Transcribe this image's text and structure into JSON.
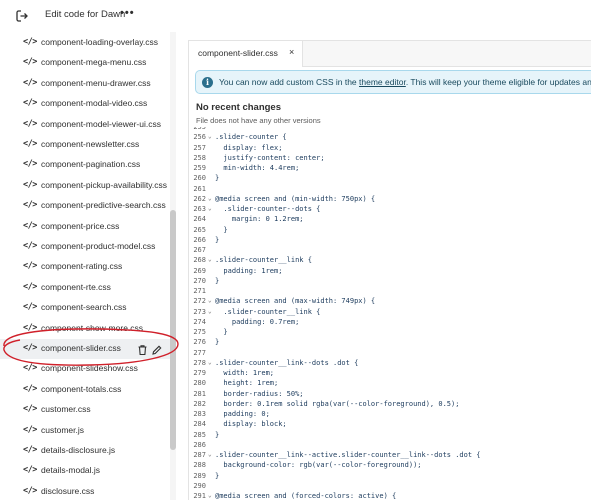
{
  "topbar": {
    "title": "Edit code for Dawn",
    "more_label": "•••",
    "exit_icon": "exit-icon"
  },
  "sidebar": {
    "files": [
      "component-loading-overlay.css",
      "component-mega-menu.css",
      "component-menu-drawer.css",
      "component-modal-video.css",
      "component-model-viewer-ui.css",
      "component-newsletter.css",
      "component-pagination.css",
      "component-pickup-availability.css",
      "component-predictive-search.css",
      "component-price.css",
      "component-product-model.css",
      "component-rating.css",
      "component-rte.css",
      "component-search.css",
      "component-show-more.css",
      "component-slider.css",
      "component-slideshow.css",
      "component-totals.css",
      "customer.css",
      "customer.js",
      "details-disclosure.js",
      "details-modal.js",
      "disclosure.css"
    ],
    "file_icon": "</>",
    "selected_index": 15
  },
  "editor": {
    "tab_label": "component-slider.css",
    "tab_close": "×",
    "banner": {
      "prefix": "You can now add custom CSS in the ",
      "link": "theme editor",
      "suffix": ". This will keep your theme eligible for updates and give you"
    },
    "recent_title": "No recent changes",
    "recent_sub": "File does not have any other versions"
  },
  "code": [
    {
      "n": "255",
      "t": ""
    },
    {
      "n": "256",
      "t": ".slider-counter {",
      "f": true
    },
    {
      "n": "257",
      "t": "  display: flex;"
    },
    {
      "n": "258",
      "t": "  justify-content: center;"
    },
    {
      "n": "259",
      "t": "  min-width: 4.4rem;"
    },
    {
      "n": "260",
      "t": "}"
    },
    {
      "n": "261",
      "t": ""
    },
    {
      "n": "262",
      "t": "@media screen and (min-width: 750px) {",
      "f": true
    },
    {
      "n": "263",
      "t": "  .slider-counter--dots {",
      "f": true,
      "hl": true
    },
    {
      "n": "264",
      "t": "    margin: 0 1.2rem;"
    },
    {
      "n": "265",
      "t": "  }"
    },
    {
      "n": "266",
      "t": "}"
    },
    {
      "n": "267",
      "t": ""
    },
    {
      "n": "268",
      "t": ".slider-counter__link {",
      "f": true
    },
    {
      "n": "269",
      "t": "  padding: 1rem;"
    },
    {
      "n": "270",
      "t": "}"
    },
    {
      "n": "271",
      "t": ""
    },
    {
      "n": "272",
      "t": "@media screen and (max-width: 749px) {",
      "f": true
    },
    {
      "n": "273",
      "t": "  .slider-counter__link {",
      "f": true
    },
    {
      "n": "274",
      "t": "    padding: 0.7rem;"
    },
    {
      "n": "275",
      "t": "  }"
    },
    {
      "n": "276",
      "t": "}"
    },
    {
      "n": "277",
      "t": ""
    },
    {
      "n": "278",
      "t": ".slider-counter__link--dots .dot {",
      "f": true
    },
    {
      "n": "279",
      "t": "  width: 1rem;"
    },
    {
      "n": "280",
      "t": "  height: 1rem;"
    },
    {
      "n": "281",
      "t": "  border-radius: 50%;"
    },
    {
      "n": "282",
      "t": "  border: 0.1rem solid rgba(var(--color-foreground), 0.5);"
    },
    {
      "n": "283",
      "t": "  padding: 0;"
    },
    {
      "n": "284",
      "t": "  display: block;"
    },
    {
      "n": "285",
      "t": "}"
    },
    {
      "n": "286",
      "t": ""
    },
    {
      "n": "287",
      "t": ".slider-counter__link--active.slider-counter__link--dots .dot {",
      "f": true
    },
    {
      "n": "288",
      "t": "  background-color: rgb(var(--color-foreground));"
    },
    {
      "n": "289",
      "t": "}"
    },
    {
      "n": "290",
      "t": ""
    },
    {
      "n": "291",
      "t": "@media screen and (forced-colors: active) {",
      "f": true
    }
  ],
  "colors": {
    "annotation": "#d0202a",
    "banner_bg": "#e6f4fa",
    "banner_icon": "#2b6f8c"
  }
}
